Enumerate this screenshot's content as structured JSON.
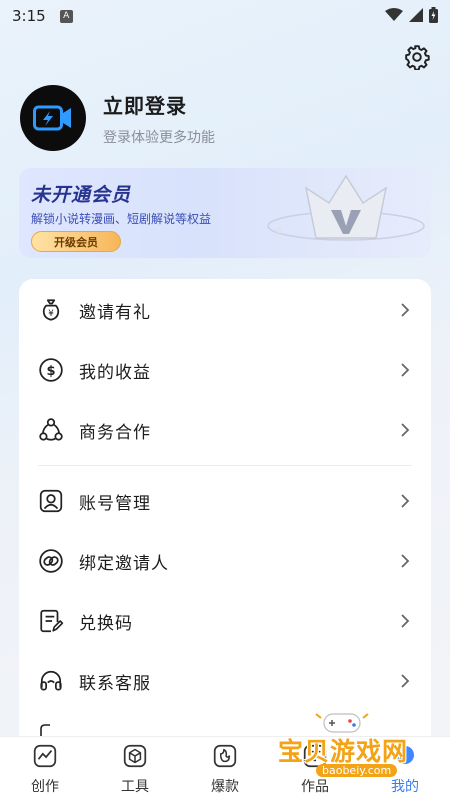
{
  "status_bar": {
    "time": "3:15",
    "notification_letter": "A"
  },
  "profile": {
    "title": "立即登录",
    "subtitle": "登录体验更多功能"
  },
  "vip": {
    "title": "未开通会员",
    "description": "解锁小说转漫画、短剧解说等权益",
    "button": "开级会员"
  },
  "menu": {
    "items": [
      {
        "label": "邀请有礼",
        "icon": "money-bag-icon"
      },
      {
        "label": "我的收益",
        "icon": "dollar-circle-icon"
      },
      {
        "label": "商务合作",
        "icon": "share-nodes-icon"
      },
      {
        "label": "账号管理",
        "icon": "user-account-icon"
      },
      {
        "label": "绑定邀请人",
        "icon": "link-icon"
      },
      {
        "label": "兑换码",
        "icon": "redeem-code-icon"
      },
      {
        "label": "联系客服",
        "icon": "headset-icon"
      }
    ]
  },
  "bottom_nav": {
    "items": [
      {
        "label": "创作",
        "icon": "create-icon"
      },
      {
        "label": "工具",
        "icon": "toolbox-icon"
      },
      {
        "label": "爆款",
        "icon": "hot-icon"
      },
      {
        "label": "作品",
        "icon": "works-icon"
      },
      {
        "label": "我的",
        "icon": "profile-icon",
        "active": true
      }
    ]
  },
  "watermark": {
    "text": "宝贝游戏网",
    "url": "baobeiy.com"
  },
  "colors": {
    "accent": "#3a7cf0",
    "vip_text": "#27348f",
    "watermark": "#f3a316"
  }
}
